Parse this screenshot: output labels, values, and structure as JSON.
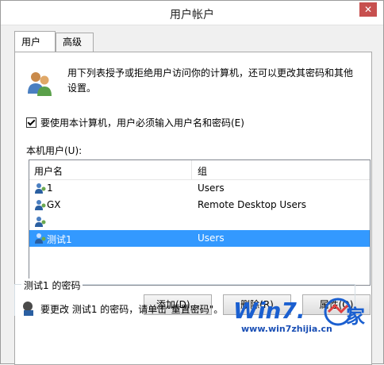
{
  "window": {
    "title": "用户帐户",
    "close_label": "✕"
  },
  "tabs": [
    {
      "label": "用户",
      "active": true
    },
    {
      "label": "高级",
      "active": false
    }
  ],
  "intro": {
    "text": "用下列表授予或拒绝用户访问你的计算机，还可以更改其密码和其他设置。",
    "icon": "users-icon"
  },
  "require_login": {
    "label": "要使用本计算机，用户必须输入用户名和密码(E)",
    "checked": true
  },
  "local_users_label": "本机用户(U):",
  "users_list": {
    "columns": [
      "用户名",
      "组"
    ],
    "rows": [
      {
        "name": "1",
        "group": "Users",
        "selected": false
      },
      {
        "name": "GX",
        "group": "Remote Desktop Users",
        "selected": false
      },
      {
        "name": "",
        "group": "",
        "selected": false
      },
      {
        "name": "测试1",
        "group": "Users",
        "selected": true
      }
    ]
  },
  "buttons": {
    "add": "添加(D)...",
    "remove": "删除(R)",
    "properties": "属性(O)"
  },
  "password_group": {
    "legend": "测试1 的密码",
    "text": "要更改 测试1 的密码，请单击\"重置密码\"。"
  },
  "watermark": {
    "logo": "Win7.",
    "glyph": "家",
    "url": "www.win7zhijia.cn"
  },
  "colors": {
    "selection": "#3399ff",
    "close_button": "#c7504f",
    "watermark": "#1a5fd0"
  }
}
